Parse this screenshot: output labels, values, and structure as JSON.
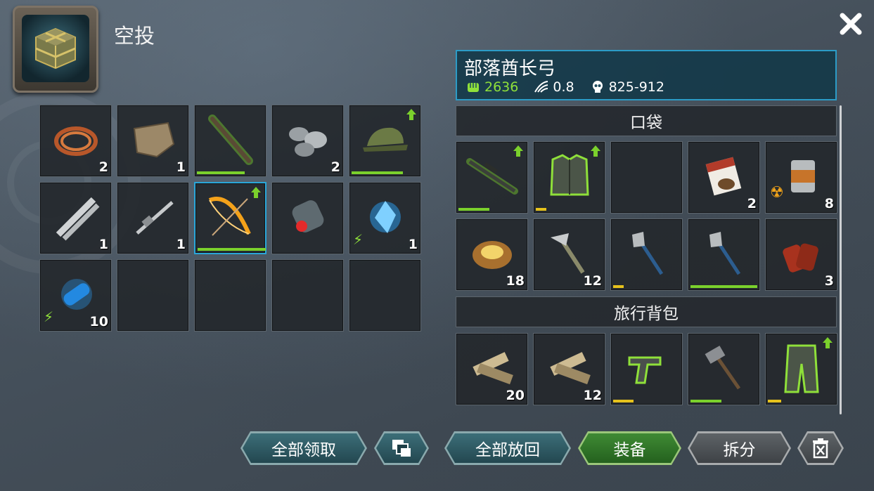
{
  "header": {
    "title": "空投"
  },
  "airdrop_slots": [
    {
      "name": "copper-wire",
      "qty": "2",
      "upgrade": false,
      "durability": null,
      "energy": false,
      "selected": false
    },
    {
      "name": "cloth",
      "qty": "1",
      "upgrade": false,
      "durability": null,
      "energy": false,
      "selected": false
    },
    {
      "name": "shotgun",
      "qty": "",
      "upgrade": false,
      "durability": 0.7,
      "energy": false,
      "selected": false
    },
    {
      "name": "stones",
      "qty": "2",
      "upgrade": false,
      "durability": null,
      "energy": false,
      "selected": false
    },
    {
      "name": "camo-cap",
      "qty": "",
      "upgrade": true,
      "durability": 0.75,
      "energy": false,
      "selected": false
    },
    {
      "name": "saw-blades",
      "qty": "1",
      "upgrade": false,
      "durability": null,
      "energy": false,
      "selected": false
    },
    {
      "name": "caliper",
      "qty": "1",
      "upgrade": false,
      "durability": null,
      "energy": false,
      "selected": false
    },
    {
      "name": "chief-bow",
      "qty": "",
      "upgrade": true,
      "durability": 1.0,
      "energy": false,
      "selected": true
    },
    {
      "name": "canister",
      "qty": "",
      "upgrade": false,
      "durability": null,
      "energy": false,
      "selected": false
    },
    {
      "name": "blue-crystal",
      "qty": "1",
      "upgrade": false,
      "durability": null,
      "energy": true,
      "selected": false
    },
    {
      "name": "energy-cell",
      "qty": "10",
      "upgrade": false,
      "durability": null,
      "energy": true,
      "selected": false
    },
    {
      "name": "empty",
      "qty": ""
    },
    {
      "name": "empty",
      "qty": ""
    },
    {
      "name": "empty",
      "qty": ""
    },
    {
      "name": "empty",
      "qty": ""
    }
  ],
  "item_info": {
    "name": "部落酋长弓",
    "power": "2636",
    "speed": "0.8",
    "damage": "825-912"
  },
  "sections": {
    "pocket_title": "口袋",
    "backpack_title": "旅行背包"
  },
  "pocket_slots": [
    {
      "name": "sniper-rifle",
      "qty": "",
      "upgrade": true,
      "durability": 0.45,
      "color": "green"
    },
    {
      "name": "armor-vest",
      "qty": "",
      "upgrade": true,
      "durability": 0.15,
      "color": "yellow"
    },
    {
      "name": "empty",
      "qty": ""
    },
    {
      "name": "tobacco-pack",
      "qty": "2"
    },
    {
      "name": "canned-food",
      "qty": "8",
      "radiation": true
    },
    {
      "name": "baked-potato",
      "qty": "18"
    },
    {
      "name": "hatchet",
      "qty": "12"
    },
    {
      "name": "axe",
      "qty": "",
      "durability": 0.15,
      "color": "yellow"
    },
    {
      "name": "axe",
      "qty": "",
      "durability": 0.98,
      "color": "green"
    },
    {
      "name": "dog-tags",
      "qty": "3"
    }
  ],
  "backpack_slots": [
    {
      "name": "wood-planks",
      "qty": "20"
    },
    {
      "name": "wood-planks",
      "qty": "12"
    },
    {
      "name": "pistol",
      "qty": "",
      "durability": 0.3,
      "color": "yellow"
    },
    {
      "name": "sledgehammer",
      "qty": "",
      "durability": 0.45,
      "color": "green"
    },
    {
      "name": "armored-pants",
      "qty": "",
      "upgrade": true,
      "durability": 0.2,
      "color": "yellow"
    }
  ],
  "buttons": {
    "take_all": "全部领取",
    "put_back_all": "全部放回",
    "equip": "装备",
    "disassemble": "拆分"
  },
  "colors": {
    "accent": "#2aa6d8",
    "power": "#8fe03a",
    "durability_green": "#7bd12c",
    "durability_yellow": "#e6c21c"
  }
}
